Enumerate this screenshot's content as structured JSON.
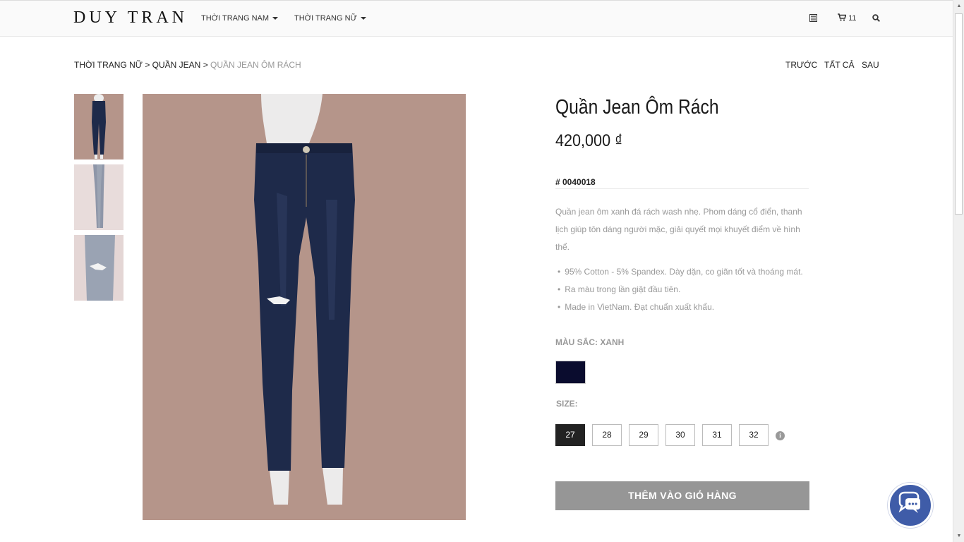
{
  "header": {
    "logo": "DUY TRAN",
    "nav": [
      {
        "label": "THỜI TRANG NAM"
      },
      {
        "label": "THỜI TRANG NỮ"
      }
    ],
    "cart_count": "11"
  },
  "breadcrumb": {
    "level1": "THỜI TRANG NỮ",
    "sep": " > ",
    "level2": "QUẦN JEAN",
    "current": "QUẦN JEAN ÔM RÁCH"
  },
  "pager": {
    "prev": "TRƯỚC",
    "all": "TẤT CẢ",
    "next": "SAU"
  },
  "product": {
    "title": "Quần Jean Ôm Rách",
    "price": "420,000 ₫",
    "sku": "# 0040018",
    "description": "Quần jean ôm xanh đá rách wash nhẹ. Phom dáng cổ điển, thanh lịch giúp tôn dáng người mặc, giải quyết mọi khuyết điểm về hình thể.",
    "features": [
      "95% Cotton - 5% Spandex. Dày dặn, co giãn tốt và thoáng mát.",
      "Ra màu trong lần giặt đầu tiên.",
      "Made in VietNam. Đạt chuẩn xuất khẩu."
    ],
    "color_label": "MÀU SẮC: XANH",
    "color_value": "#0a0c2e",
    "size_label": "SIZE:",
    "sizes": [
      "27",
      "28",
      "29",
      "30",
      "31",
      "32"
    ],
    "selected_size": "27",
    "add_to_cart": "THÊM VÀO GIỎ HÀNG"
  },
  "colors": {
    "image_bg": "#b5958a",
    "denim": "#1e2a4a",
    "chat_button": "#3f5ca8"
  }
}
